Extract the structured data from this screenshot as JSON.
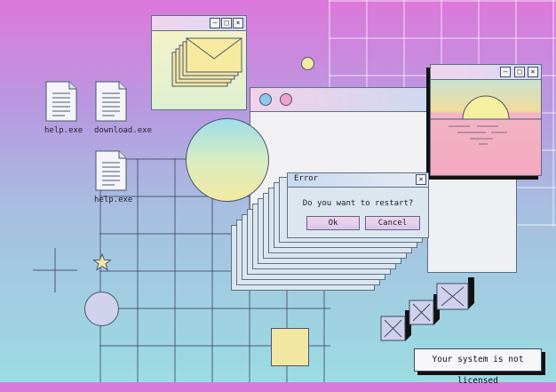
{
  "desktop": {
    "icons": [
      {
        "label": "help.exe"
      },
      {
        "label": "download.exe"
      },
      {
        "label": "help.exe"
      }
    ]
  },
  "dialog": {
    "title": "Error",
    "message": "Do you want to restart?",
    "ok_label": "Ok",
    "cancel_label": "Cancel",
    "close_glyph": "×"
  },
  "mail_window": {
    "minimize_glyph": "–",
    "maximize_glyph": "□",
    "close_glyph": "×"
  },
  "sunset_window": {
    "minimize_glyph": "–",
    "maximize_glyph": "□",
    "close_glyph": "×"
  },
  "status_message": "Your system is not licensed",
  "icons": [
    "document-icon",
    "envelope-icon",
    "star-icon",
    "crosshair-icon",
    "close-box-icon"
  ],
  "colors": {
    "bg_top": "#dd78dc",
    "bg_bottom": "#9bdce2",
    "window_border": "#5f6f88",
    "sun": "#f5e9a0"
  }
}
